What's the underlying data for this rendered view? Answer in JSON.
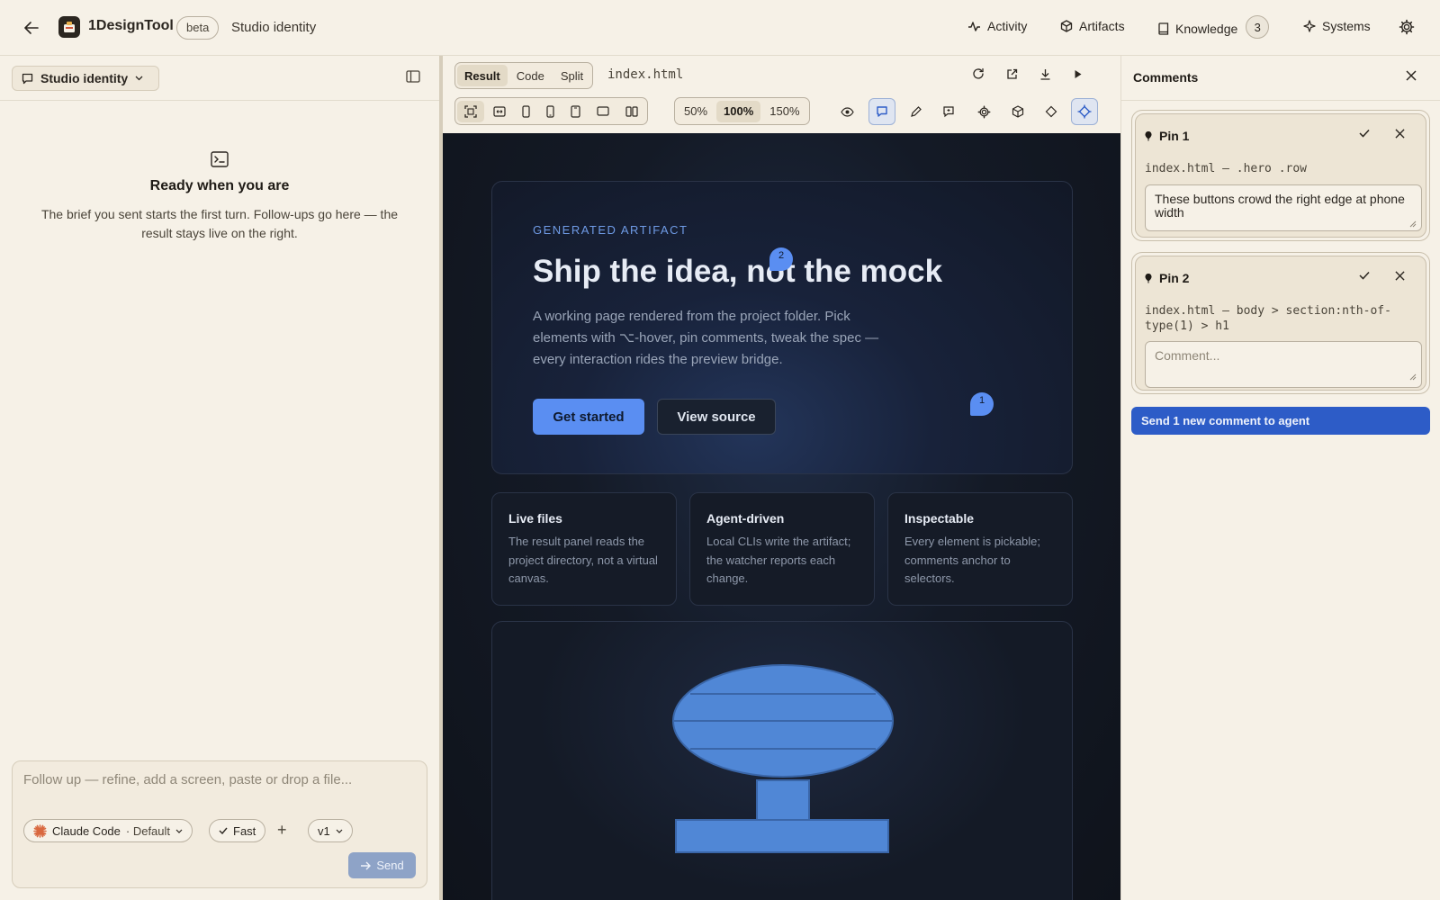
{
  "topbar": {
    "app_name": "1DesignTool",
    "beta_label": "beta",
    "project_title": "Studio identity",
    "nav": [
      {
        "label": "Activity",
        "icon": "activity-icon"
      },
      {
        "label": "Artifacts",
        "icon": "cube-icon"
      },
      {
        "label": "Knowledge",
        "icon": "book-icon",
        "badge": "3"
      },
      {
        "label": "Systems",
        "icon": "sparkle-icon"
      }
    ]
  },
  "left": {
    "project_select": "Studio identity",
    "empty_title": "Ready when you are",
    "empty_text": "The brief you sent starts the first turn. Follow-ups go here — the result stays live on the right.",
    "composer": {
      "placeholder": "Follow up — refine, add a screen, paste or drop a file...",
      "agent_label": "Claude Code",
      "agent_mode": "· Default",
      "speed_label": "Fast",
      "version_label": "v1",
      "send_label": "Send"
    }
  },
  "center": {
    "view_tabs": [
      "Result",
      "Code",
      "Split"
    ],
    "active_view": "Result",
    "filename": "index.html",
    "zoom_options": [
      "50%",
      "100%",
      "150%"
    ],
    "active_zoom": "100%",
    "preview": {
      "eyebrow": "GENERATED ARTIFACT",
      "title": "Ship the idea, not the mock",
      "text": "A working page rendered from the project folder. Pick elements with ⌥-hover, pin comments, tweak the spec — every interaction rides the preview bridge.",
      "primary_button": "Get started",
      "secondary_button": "View source",
      "pin_markers": [
        "2",
        "1"
      ],
      "cards": [
        {
          "title": "Live files",
          "text": "The result panel reads the project directory, not a virtual canvas."
        },
        {
          "title": "Agent-driven",
          "text": "Local CLIs write the artifact; the watcher reports each change."
        },
        {
          "title": "Inspectable",
          "text": "Every element is pickable; comments anchor to selectors."
        }
      ]
    }
  },
  "comments": {
    "title": "Comments",
    "pins": [
      {
        "label": "Pin 1",
        "selector": "index.html — .hero .row",
        "text": "These buttons crowd the right edge at phone width",
        "placeholder": ""
      },
      {
        "label": "Pin 2",
        "selector": "index.html — body > section:nth-of-type(1) > h1",
        "text": "",
        "placeholder": "Comment..."
      }
    ],
    "send_label": "Send 1 new comment to agent"
  },
  "colors": {
    "accent": "#5a8ef2",
    "send_button": "#2d5cc7",
    "background": "#f6f1e7",
    "preview_bg": "#141a26"
  }
}
